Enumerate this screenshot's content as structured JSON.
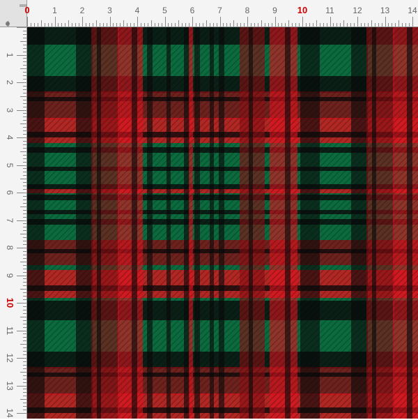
{
  "ruler": {
    "unit_marks": [
      "0",
      "1",
      "2",
      "3",
      "4",
      "5",
      "6",
      "7",
      "8",
      "9",
      "10",
      "11",
      "12",
      "13",
      "14"
    ],
    "accent_marks": [
      "0",
      "10"
    ],
    "label_color": "#666666",
    "accent_color": "#cc0000"
  },
  "fabric": {
    "pattern": "tartan plaid",
    "colors": {
      "green": "#0b6b3e",
      "red": "#e0141e",
      "dark_red": "#8a0e14",
      "black": "#0a0a0a"
    }
  }
}
